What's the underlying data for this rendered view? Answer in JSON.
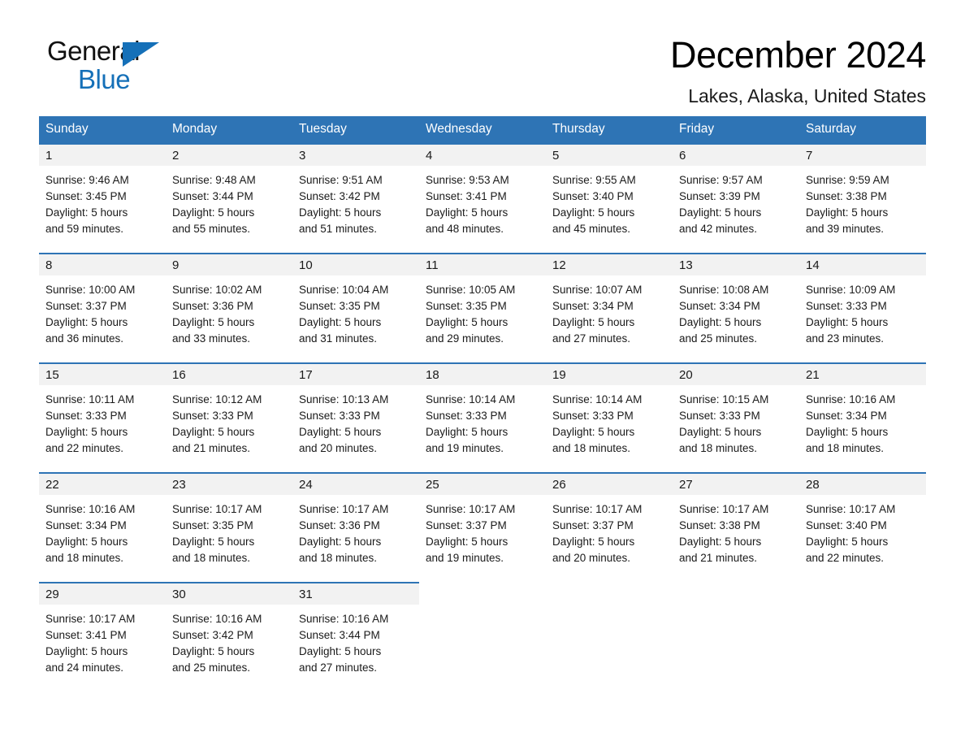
{
  "brand": {
    "name_part1": "General",
    "name_part2": "Blue",
    "accent_color": "#1570b8",
    "logo_icon": "triangle-icon"
  },
  "header": {
    "month_title": "December 2024",
    "location": "Lakes, Alaska, United States"
  },
  "calendar": {
    "header_bg_color": "#2e74b5",
    "daynum_bg_color": "#f2f2f2",
    "weekday_headers": [
      "Sunday",
      "Monday",
      "Tuesday",
      "Wednesday",
      "Thursday",
      "Friday",
      "Saturday"
    ],
    "weeks": [
      [
        {
          "day": "1",
          "sunrise": "Sunrise: 9:46 AM",
          "sunset": "Sunset: 3:45 PM",
          "daylight_line1": "Daylight: 5 hours",
          "daylight_line2": "and 59 minutes."
        },
        {
          "day": "2",
          "sunrise": "Sunrise: 9:48 AM",
          "sunset": "Sunset: 3:44 PM",
          "daylight_line1": "Daylight: 5 hours",
          "daylight_line2": "and 55 minutes."
        },
        {
          "day": "3",
          "sunrise": "Sunrise: 9:51 AM",
          "sunset": "Sunset: 3:42 PM",
          "daylight_line1": "Daylight: 5 hours",
          "daylight_line2": "and 51 minutes."
        },
        {
          "day": "4",
          "sunrise": "Sunrise: 9:53 AM",
          "sunset": "Sunset: 3:41 PM",
          "daylight_line1": "Daylight: 5 hours",
          "daylight_line2": "and 48 minutes."
        },
        {
          "day": "5",
          "sunrise": "Sunrise: 9:55 AM",
          "sunset": "Sunset: 3:40 PM",
          "daylight_line1": "Daylight: 5 hours",
          "daylight_line2": "and 45 minutes."
        },
        {
          "day": "6",
          "sunrise": "Sunrise: 9:57 AM",
          "sunset": "Sunset: 3:39 PM",
          "daylight_line1": "Daylight: 5 hours",
          "daylight_line2": "and 42 minutes."
        },
        {
          "day": "7",
          "sunrise": "Sunrise: 9:59 AM",
          "sunset": "Sunset: 3:38 PM",
          "daylight_line1": "Daylight: 5 hours",
          "daylight_line2": "and 39 minutes."
        }
      ],
      [
        {
          "day": "8",
          "sunrise": "Sunrise: 10:00 AM",
          "sunset": "Sunset: 3:37 PM",
          "daylight_line1": "Daylight: 5 hours",
          "daylight_line2": "and 36 minutes."
        },
        {
          "day": "9",
          "sunrise": "Sunrise: 10:02 AM",
          "sunset": "Sunset: 3:36 PM",
          "daylight_line1": "Daylight: 5 hours",
          "daylight_line2": "and 33 minutes."
        },
        {
          "day": "10",
          "sunrise": "Sunrise: 10:04 AM",
          "sunset": "Sunset: 3:35 PM",
          "daylight_line1": "Daylight: 5 hours",
          "daylight_line2": "and 31 minutes."
        },
        {
          "day": "11",
          "sunrise": "Sunrise: 10:05 AM",
          "sunset": "Sunset: 3:35 PM",
          "daylight_line1": "Daylight: 5 hours",
          "daylight_line2": "and 29 minutes."
        },
        {
          "day": "12",
          "sunrise": "Sunrise: 10:07 AM",
          "sunset": "Sunset: 3:34 PM",
          "daylight_line1": "Daylight: 5 hours",
          "daylight_line2": "and 27 minutes."
        },
        {
          "day": "13",
          "sunrise": "Sunrise: 10:08 AM",
          "sunset": "Sunset: 3:34 PM",
          "daylight_line1": "Daylight: 5 hours",
          "daylight_line2": "and 25 minutes."
        },
        {
          "day": "14",
          "sunrise": "Sunrise: 10:09 AM",
          "sunset": "Sunset: 3:33 PM",
          "daylight_line1": "Daylight: 5 hours",
          "daylight_line2": "and 23 minutes."
        }
      ],
      [
        {
          "day": "15",
          "sunrise": "Sunrise: 10:11 AM",
          "sunset": "Sunset: 3:33 PM",
          "daylight_line1": "Daylight: 5 hours",
          "daylight_line2": "and 22 minutes."
        },
        {
          "day": "16",
          "sunrise": "Sunrise: 10:12 AM",
          "sunset": "Sunset: 3:33 PM",
          "daylight_line1": "Daylight: 5 hours",
          "daylight_line2": "and 21 minutes."
        },
        {
          "day": "17",
          "sunrise": "Sunrise: 10:13 AM",
          "sunset": "Sunset: 3:33 PM",
          "daylight_line1": "Daylight: 5 hours",
          "daylight_line2": "and 20 minutes."
        },
        {
          "day": "18",
          "sunrise": "Sunrise: 10:14 AM",
          "sunset": "Sunset: 3:33 PM",
          "daylight_line1": "Daylight: 5 hours",
          "daylight_line2": "and 19 minutes."
        },
        {
          "day": "19",
          "sunrise": "Sunrise: 10:14 AM",
          "sunset": "Sunset: 3:33 PM",
          "daylight_line1": "Daylight: 5 hours",
          "daylight_line2": "and 18 minutes."
        },
        {
          "day": "20",
          "sunrise": "Sunrise: 10:15 AM",
          "sunset": "Sunset: 3:33 PM",
          "daylight_line1": "Daylight: 5 hours",
          "daylight_line2": "and 18 minutes."
        },
        {
          "day": "21",
          "sunrise": "Sunrise: 10:16 AM",
          "sunset": "Sunset: 3:34 PM",
          "daylight_line1": "Daylight: 5 hours",
          "daylight_line2": "and 18 minutes."
        }
      ],
      [
        {
          "day": "22",
          "sunrise": "Sunrise: 10:16 AM",
          "sunset": "Sunset: 3:34 PM",
          "daylight_line1": "Daylight: 5 hours",
          "daylight_line2": "and 18 minutes."
        },
        {
          "day": "23",
          "sunrise": "Sunrise: 10:17 AM",
          "sunset": "Sunset: 3:35 PM",
          "daylight_line1": "Daylight: 5 hours",
          "daylight_line2": "and 18 minutes."
        },
        {
          "day": "24",
          "sunrise": "Sunrise: 10:17 AM",
          "sunset": "Sunset: 3:36 PM",
          "daylight_line1": "Daylight: 5 hours",
          "daylight_line2": "and 18 minutes."
        },
        {
          "day": "25",
          "sunrise": "Sunrise: 10:17 AM",
          "sunset": "Sunset: 3:37 PM",
          "daylight_line1": "Daylight: 5 hours",
          "daylight_line2": "and 19 minutes."
        },
        {
          "day": "26",
          "sunrise": "Sunrise: 10:17 AM",
          "sunset": "Sunset: 3:37 PM",
          "daylight_line1": "Daylight: 5 hours",
          "daylight_line2": "and 20 minutes."
        },
        {
          "day": "27",
          "sunrise": "Sunrise: 10:17 AM",
          "sunset": "Sunset: 3:38 PM",
          "daylight_line1": "Daylight: 5 hours",
          "daylight_line2": "and 21 minutes."
        },
        {
          "day": "28",
          "sunrise": "Sunrise: 10:17 AM",
          "sunset": "Sunset: 3:40 PM",
          "daylight_line1": "Daylight: 5 hours",
          "daylight_line2": "and 22 minutes."
        }
      ],
      [
        {
          "day": "29",
          "sunrise": "Sunrise: 10:17 AM",
          "sunset": "Sunset: 3:41 PM",
          "daylight_line1": "Daylight: 5 hours",
          "daylight_line2": "and 24 minutes."
        },
        {
          "day": "30",
          "sunrise": "Sunrise: 10:16 AM",
          "sunset": "Sunset: 3:42 PM",
          "daylight_line1": "Daylight: 5 hours",
          "daylight_line2": "and 25 minutes."
        },
        {
          "day": "31",
          "sunrise": "Sunrise: 10:16 AM",
          "sunset": "Sunset: 3:44 PM",
          "daylight_line1": "Daylight: 5 hours",
          "daylight_line2": "and 27 minutes."
        },
        {
          "day": "",
          "sunrise": "",
          "sunset": "",
          "daylight_line1": "",
          "daylight_line2": ""
        },
        {
          "day": "",
          "sunrise": "",
          "sunset": "",
          "daylight_line1": "",
          "daylight_line2": ""
        },
        {
          "day": "",
          "sunrise": "",
          "sunset": "",
          "daylight_line1": "",
          "daylight_line2": ""
        },
        {
          "day": "",
          "sunrise": "",
          "sunset": "",
          "daylight_line1": "",
          "daylight_line2": ""
        }
      ]
    ]
  }
}
